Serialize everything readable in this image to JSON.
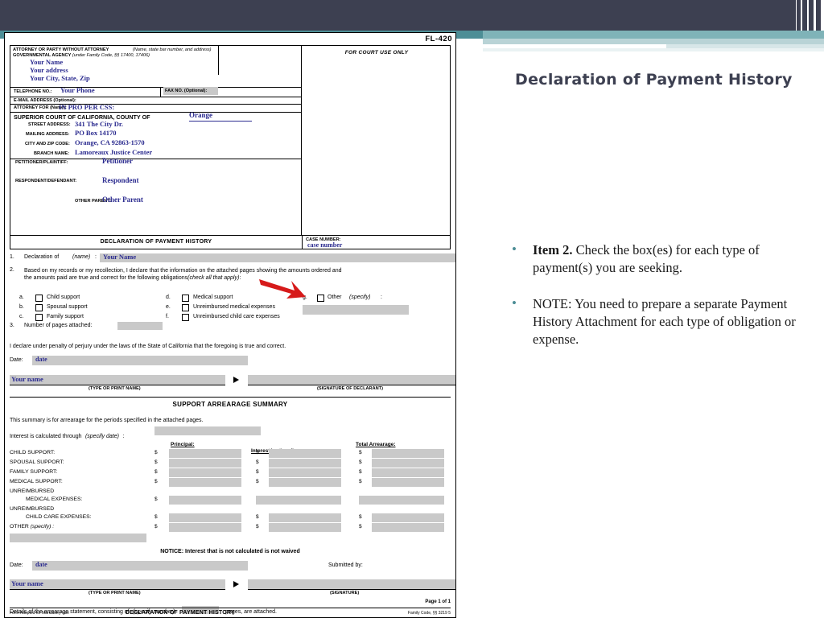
{
  "slide": {
    "title": "Declaration of Payment History",
    "bullets": [
      {
        "strong": "Item 2.",
        "text": " Check the box(es) for each type of payment(s) you are seeking."
      },
      {
        "strong": "",
        "text": "NOTE:  You need to prepare a separate Payment History Attachment for each type of obligation or expense."
      }
    ],
    "accent_color": "#4d8e96",
    "band_color": "#3d4051"
  },
  "form": {
    "form_number": "FL-420",
    "attorney_block": {
      "label_line1": "ATTORNEY OR PARTY WITHOUT ATTORNEY",
      "label_line1_italic": "(Name, state bar number, and address)",
      "label_line2": "GOVERNMENTAL AGENCY",
      "label_line2_italic": "(under Family Code, §§ 17400, 17406)",
      "name": "Your Name",
      "address": "Your address",
      "citystatezip": "Your City, State, Zip",
      "telephone_label": "TELEPHONE NO.:",
      "telephone_value": "Your Phone",
      "fax_label": "FAX NO. (Optional):",
      "email_label": "E-MAIL ADDRESS (Optional):",
      "attorney_for_label": "ATTORNEY FOR (Name):",
      "attorney_for_value": "IN PRO PER   CSS:"
    },
    "court_block": {
      "heading": "SUPERIOR COURT OF CALIFORNIA, COUNTY OF",
      "county": "Orange",
      "street_label": "STREET ADDRESS:",
      "street_value": "341 The City Dr.",
      "mailing_label": "MAILING ADDRESS:",
      "mailing_value": "PO Box 14170",
      "citystate_label": "CITY AND ZIP CODE:",
      "citystate_value": "Orange, CA  92863-1570",
      "branch_label": "BRANCH NAME:",
      "branch_value": "Lamoreaux Justice Center"
    },
    "parties": {
      "petitioner_label": "PETITIONER/PLAINTIFF:",
      "petitioner_value": "Petitioner",
      "respondent_label": "RESPONDENT/DEFENDANT:",
      "respondent_value": "Respondent",
      "other_parent_label": "OTHER PARENT:",
      "other_parent_value": "Other Parent"
    },
    "for_court_use": "FOR COURT USE ONLY",
    "doc_title_bar": "DECLARATION OF PAYMENT HISTORY",
    "case_number_label": "CASE NUMBER:",
    "case_number_value": "case number",
    "item1": {
      "num": "1.",
      "text": "Declaration of",
      "italic": "(name)",
      "colon": ":",
      "value": "Your Name"
    },
    "item2": {
      "num": "2.",
      "line1": "Based on my records or my recollection, I declare that the information on the attached pages showing the amounts ordered and",
      "line2": "the amounts paid are true and correct for the following obligations",
      "line2_italic": "(check all that apply)",
      "line2_end": ":",
      "options": [
        {
          "letter": "a.",
          "label": "Child support"
        },
        {
          "letter": "b.",
          "label": "Spousal support"
        },
        {
          "letter": "c.",
          "label": "Family support"
        },
        {
          "letter": "d.",
          "label": "Medical support"
        },
        {
          "letter": "e.",
          "label": "Unreimbursed medical expenses"
        },
        {
          "letter": "f.",
          "label": "Unreimbursed child care expenses"
        },
        {
          "letter": "g.",
          "label": "Other",
          "italic": "(specify)",
          "colon": ":"
        }
      ]
    },
    "item3": {
      "num": "3.",
      "text": "Number of pages attached:"
    },
    "perjury": "I declare under penalty of perjury under the laws of the State of California that the foregoing is true and correct.",
    "date_label": "Date:",
    "date_value": "date",
    "signature_name_value": "Your name",
    "type_print_label": "(TYPE OR PRINT NAME)",
    "signature_label": "(SIGNATURE OF DECLARANT)",
    "arrearage": {
      "title": "SUPPORT ARREARAGE SUMMARY",
      "intro": "This summary is for arrearage for the periods specified in the attached pages.",
      "interest_label": "Interest is calculated through",
      "interest_italic": "(specify date)",
      "interest_colon": ":",
      "columns": [
        "Principal:",
        "Interest (optional) :",
        "Total Arrearage:"
      ],
      "col2_plain": "Interest",
      "col2_italic": "(optional)",
      "rows": [
        {
          "label": "CHILD SUPPORT:",
          "label2": ""
        },
        {
          "label": "SPOUSAL SUPPORT:",
          "label2": ""
        },
        {
          "label": "FAMILY SUPPORT:",
          "label2": ""
        },
        {
          "label": "MEDICAL SUPPORT:",
          "label2": ""
        },
        {
          "label": "UNREIMBURSED",
          "label2": "MEDICAL EXPENSES:"
        },
        {
          "label": "UNREIMBURSED",
          "label2": "CHILD CARE EXPENSES:"
        },
        {
          "label": "OTHER",
          "label2": "(specify) :"
        }
      ],
      "dollar": "$",
      "notice": "NOTICE: Interest that is not calculated is not waived",
      "date_label": "Date:",
      "date_value": "date",
      "submitted_by": "Submitted by:",
      "sig_name_value": "Your name",
      "type_print_label": "(TYPE OR PRINT NAME)",
      "signature_label": "(SIGNATURE)",
      "details_pre": "Details of the arrearage statement, consisting of",
      "details_italic": "(specify number)",
      "details_post": "pages, are attached."
    },
    "footer": {
      "left": "Form Adopted for Mandatory Use",
      "left2": "Judicial Council of California",
      "center": "DECLARATION OF PAYMENT HISTORY",
      "right": "Family Code, §§ 3219 5",
      "page": "Page 1 of 1"
    }
  }
}
